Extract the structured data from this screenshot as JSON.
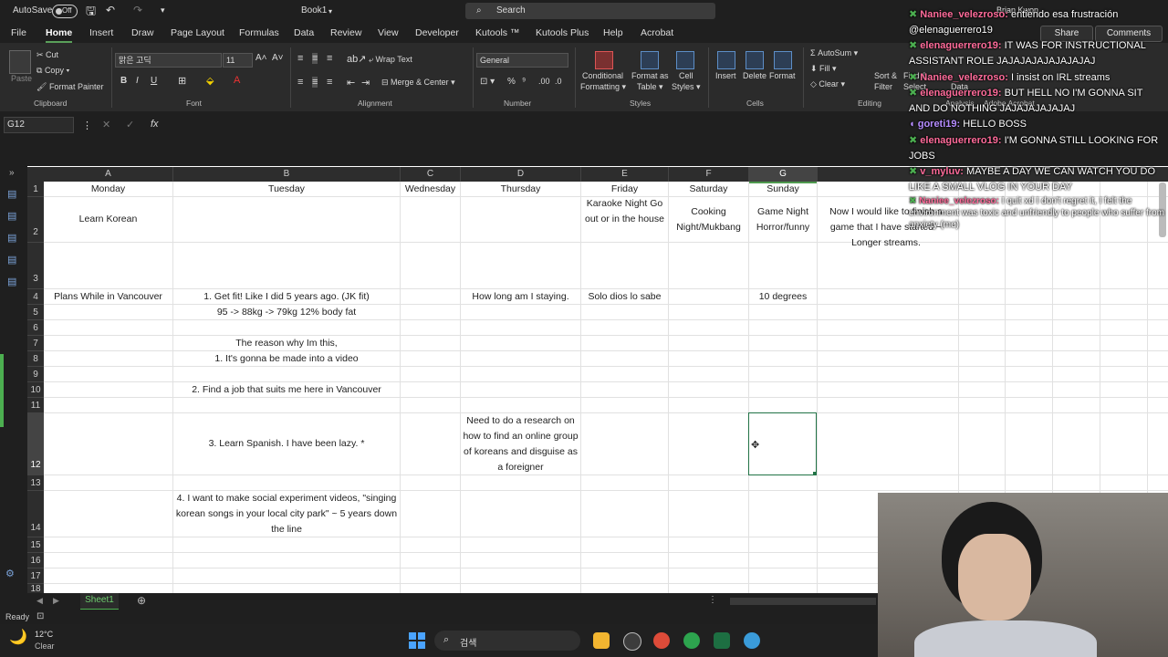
{
  "titlebar": {
    "autosave": "AutoSave",
    "autosave_state": "Off",
    "book": "Book1",
    "search": "Search",
    "user": "Brian Kwon"
  },
  "menu": {
    "tabs": [
      "File",
      "Home",
      "Insert",
      "Draw",
      "Page Layout",
      "Formulas",
      "Data",
      "Review",
      "View",
      "Developer",
      "Kutools ™",
      "Kutools Plus",
      "Help",
      "Acrobat"
    ],
    "share": "Share",
    "comments": "Comments"
  },
  "ribbon": {
    "cut": "Cut",
    "copy": "Copy",
    "format_painter": "Format Painter",
    "paste": "Paste",
    "font_name": "맑은 고딕",
    "font_size": "11",
    "wrap_text": "Wrap Text",
    "merge_center": "Merge & Center",
    "number_format": "General",
    "conditional": "Conditional",
    "formatting": "Formatting",
    "format_as": "Format as",
    "table": "Table",
    "cell": "Cell",
    "styles_btn": "Styles",
    "insert": "Insert",
    "delete": "Delete",
    "format": "Format",
    "autosum": "AutoSum",
    "fill": "Fill",
    "clear": "Clear",
    "sort": "Sort &",
    "filter": "Filter",
    "select": "Select",
    "find": "Find &",
    "data": "Data",
    "analysis": "Analysis",
    "adobe": "Adobe Acrobat",
    "groups": {
      "clipboard": "Clipboard",
      "font": "Font",
      "alignment": "Alignment",
      "number": "Number",
      "styles": "Styles",
      "cells": "Cells",
      "editing": "Editing"
    }
  },
  "formula": {
    "namebox": "G12",
    "fx": "fx"
  },
  "columns": [
    "A",
    "B",
    "C",
    "D",
    "E",
    "F",
    "G"
  ],
  "rows": [
    "1",
    "2",
    "3",
    "4",
    "5",
    "6",
    "7",
    "8",
    "9",
    "10",
    "11",
    "12",
    "13",
    "14",
    "15",
    "16",
    "17",
    "18"
  ],
  "cells": {
    "a1": "Monday",
    "b1": "Tuesday",
    "c1": "Wednesday",
    "d1": "Thursday",
    "e1": "Friday",
    "f1": "Saturday",
    "g1": "Sunday",
    "a2": "Learn Korean",
    "e2": "Karaoke Night Go out or in the house",
    "f2": "Cooking Night/Mukbang",
    "g2": "Game Night Horror/funny",
    "h2": "Now I would like to finish a game that I have started ~ Longer streams.",
    "a4": "Plans While in Vancouver",
    "b4": "1. Get fit! Like I did 5 years ago. (JK fit)",
    "d4": "How long am I staying.",
    "e4": "Solo dios lo sabe",
    "g4": "10 degrees",
    "b5": "95 -> 88kg -> 79kg 12% body fat",
    "b7": "The reason why Im this,",
    "b8": "1. It's gonna be made into a video",
    "b10": "2. Find a job that suits me here in Vancouver",
    "b12": "3. Learn Spanish. I have been lazy. *",
    "d12": "Need to do a research on how to find an online group of koreans and disguise as a foreigner",
    "b14": "4. I want to make social experiment videos, \"singing korean songs in your local city park\" ~ 5 years down the line"
  },
  "chat": [
    {
      "user": "Naniee_velezroso:",
      "msg": " entiendo esa frustración @elenaguerrero19",
      "color": "#ff6b9a"
    },
    {
      "user": "elenaguerrero19:",
      "msg": " IT WAS FOR INSTRUCTIONAL ASSISTANT ROLE JAJAJAJAJAJAJAJAJ",
      "color": "#ff6b9a"
    },
    {
      "user": "Naniee_velezroso:",
      "msg": " I insist on IRL streams",
      "color": "#ff6b9a"
    },
    {
      "user": "elenaguerrero19:",
      "msg": " BUT HELL NO I'M GONNA SIT AND DO NOTHING JAJAJAJAJAJAJ",
      "color": "#ff6b9a"
    },
    {
      "user": "goreti19:",
      "msg": " HELLO BOSS",
      "color": "#b58cff"
    },
    {
      "user": "elenaguerrero19:",
      "msg": " I'M GONNA STILL LOOKING FOR JOBS",
      "color": "#ff6b9a"
    },
    {
      "user": "v_myluv:",
      "msg": " MAYBE A DAY WE CAN WATCH YOU DO LIKE A SMALL VLOG IN YOUR DAY",
      "color": "#ff6b9a"
    },
    {
      "user": "Naniee_velezroso:",
      "msg": " I quit xd I don't regret it, I felt the environment was toxic and unfriendly to people who suffer from anxiety (me)",
      "color": "#ff6b9a"
    }
  ],
  "sheet": {
    "tab": "Sheet1",
    "status": "Ready"
  },
  "weather": {
    "temp": "12°C",
    "desc": "Clear"
  },
  "taskbar": {
    "search": "검색"
  }
}
